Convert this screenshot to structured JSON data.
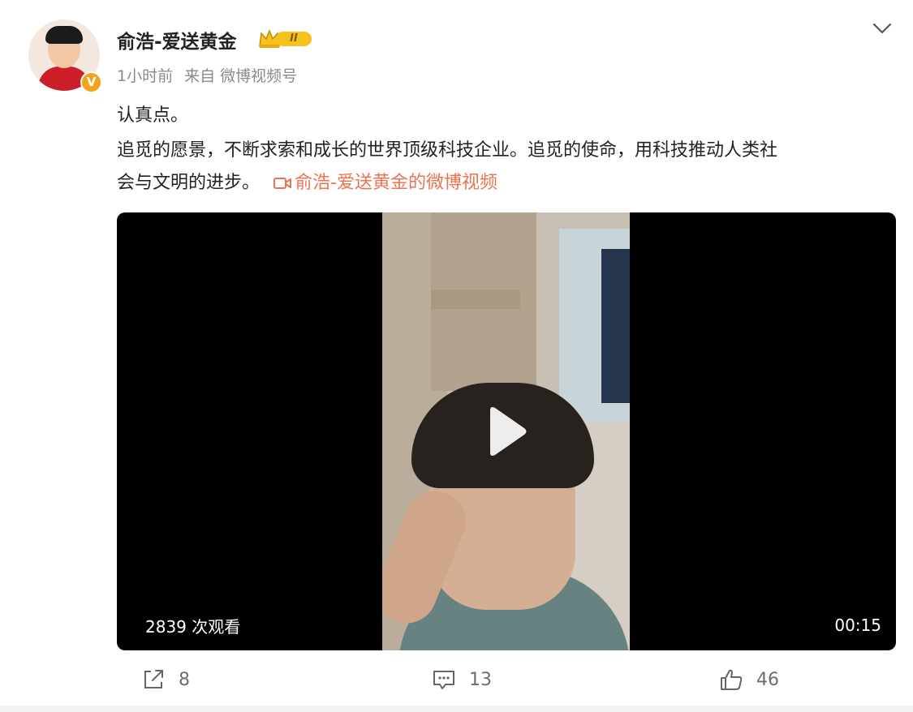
{
  "post": {
    "username": "俞浩-爱送黄金",
    "rank_label": "II",
    "time": "1小时前",
    "source": "来自 微博视频号",
    "verified_mark": "V",
    "text_line1": "认真点。",
    "text_line2": "追觅的愿景，不断求索和成长的世界顶级科技企业。追觅的使命，用科技推动人类社",
    "text_line3": "会与文明的进步。",
    "video_link_label": "俞浩-爱送黄金的微博视频"
  },
  "video": {
    "views": "2839 次观看",
    "duration": "00:15"
  },
  "actions": {
    "share_count": "8",
    "comment_count": "13",
    "like_count": "46"
  },
  "colors": {
    "link": "#eb7350",
    "rank_badge": "#f6c31c",
    "verified": "#f4a21c"
  }
}
